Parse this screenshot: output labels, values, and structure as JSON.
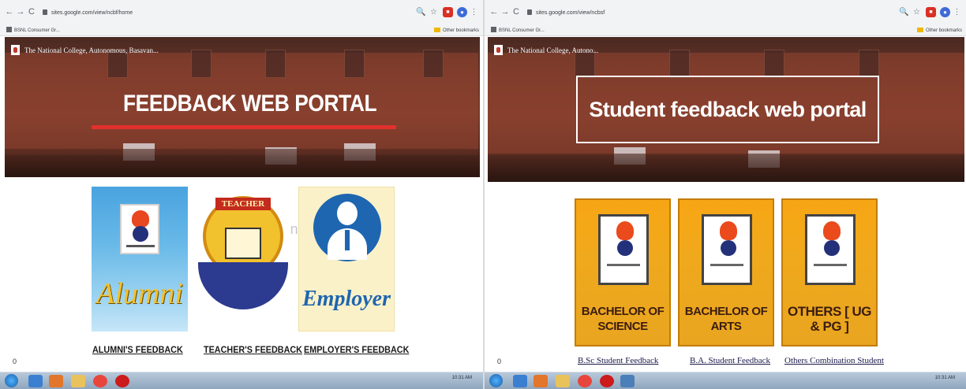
{
  "left": {
    "address": "sites.google.com/view/ncbf/home",
    "bookmark": "BSNL Consumer Gr...",
    "other_bookmarks": "Other bookmarks",
    "site_title": "The National College, Autonomous, Basavan...",
    "heading": "FEEDBACK WEB PORTAL",
    "cards": [
      {
        "art_text": "Alumni",
        "link": "ALUMNI'S FEEDBACK"
      },
      {
        "art_text": "TEACHER",
        "link": "TEACHER'S FEEDBACK"
      },
      {
        "art_text": "Employer",
        "link": "EMPLOYER'S FEEDBACK"
      }
    ],
    "page_number": "0",
    "clock_time": "10:31 AM"
  },
  "right": {
    "address": "sites.google.com/view/ncbsf",
    "bookmark": "BSNL Consumer Gr...",
    "other_bookmarks": "Other bookmarks",
    "site_title": "The National College, Autono...",
    "heading": "Student feedback web portal",
    "cards": [
      {
        "art_text": "BACHELOR OF SCIENCE",
        "link": "B.Sc Student Feedback"
      },
      {
        "art_text": "BACHELOR OF ARTS",
        "link": "B.A. Student Feedback"
      },
      {
        "art_text": "OTHERS [ UG & PG ]",
        "link": "Others Combination Student"
      }
    ],
    "page_number": "0",
    "clock_time": "10:31 AM"
  },
  "icons": {
    "back": "←",
    "forward": "→",
    "reload": "C",
    "search": "🔍",
    "star": "☆",
    "menu": "⋮"
  },
  "colors": {
    "underline_red": "#e2312d",
    "card_orange": "#f0a91c",
    "browser_chrome": "#f1f3f4"
  }
}
